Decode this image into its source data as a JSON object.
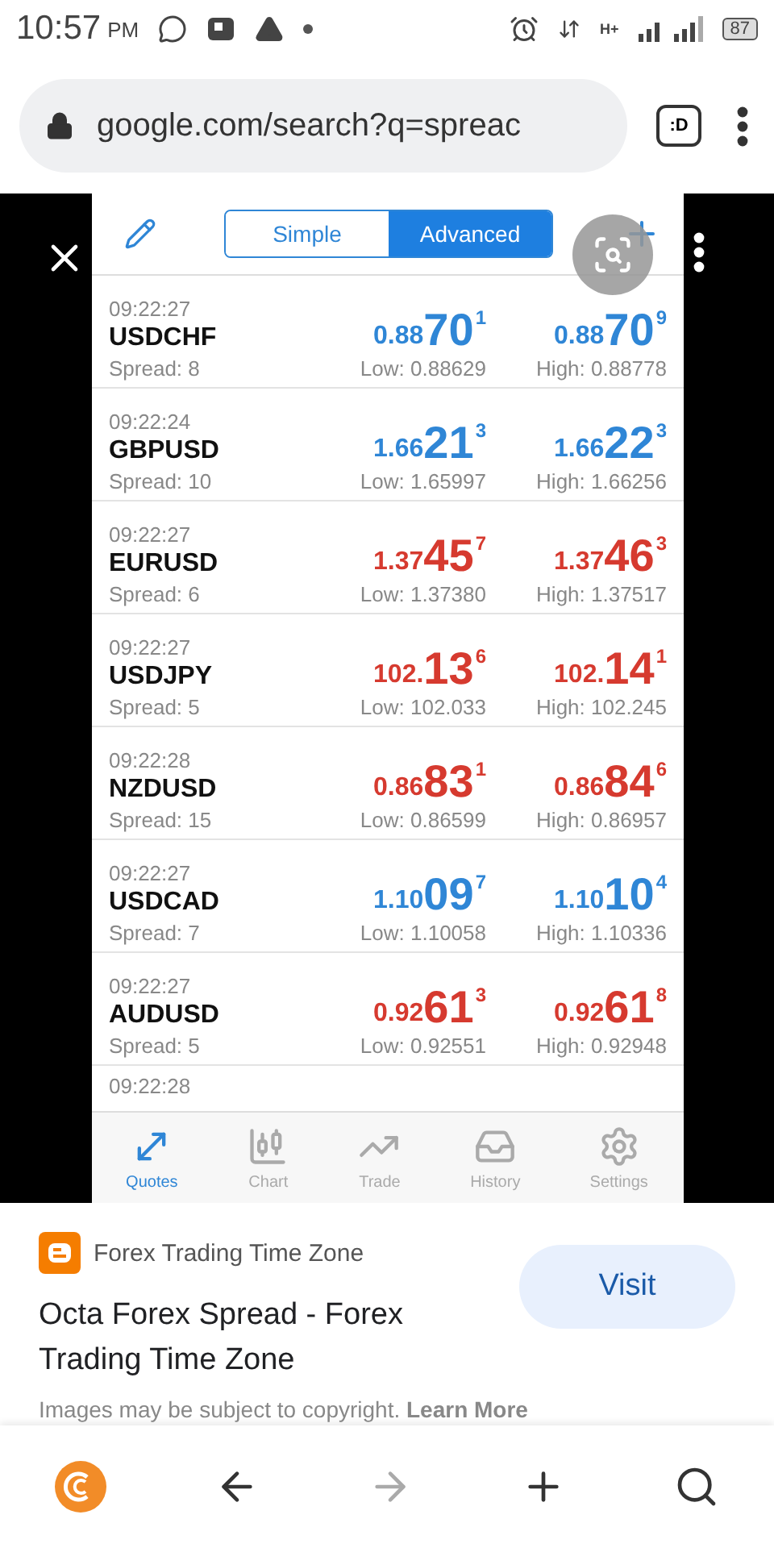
{
  "status_bar": {
    "time": "10:57",
    "ampm": "PM",
    "network": "H+",
    "battery": "87"
  },
  "address_bar": {
    "url": "google.com/search?q=spreac",
    "tab_switcher": ":D"
  },
  "viewer": {
    "segments": [
      {
        "label": "Simple",
        "selected": false
      },
      {
        "label": "Advanced",
        "selected": true
      }
    ],
    "quotes": [
      {
        "time": "09:22:27",
        "symbol": "USDCHF",
        "spread": "Spread: 8",
        "color": "#2f86d6",
        "bid": {
          "head": "0.88",
          "big": "70",
          "tail": "1"
        },
        "ask": {
          "head": "0.88",
          "big": "70",
          "tail": "9"
        },
        "low": "Low: 0.88629",
        "high": "High: 0.88778"
      },
      {
        "time": "09:22:24",
        "symbol": "GBPUSD",
        "spread": "Spread: 10",
        "color": "#2f86d6",
        "bid": {
          "head": "1.66",
          "big": "21",
          "tail": "3"
        },
        "ask": {
          "head": "1.66",
          "big": "22",
          "tail": "3"
        },
        "low": "Low: 1.65997",
        "high": "High: 1.66256"
      },
      {
        "time": "09:22:27",
        "symbol": "EURUSD",
        "spread": "Spread: 6",
        "color": "#d63a2f",
        "bid": {
          "head": "1.37",
          "big": "45",
          "tail": "7"
        },
        "ask": {
          "head": "1.37",
          "big": "46",
          "tail": "3"
        },
        "low": "Low: 1.37380",
        "high": "High: 1.37517"
      },
      {
        "time": "09:22:27",
        "symbol": "USDJPY",
        "spread": "Spread: 5",
        "color": "#d63a2f",
        "bid": {
          "head": "102.",
          "big": "13",
          "tail": "6"
        },
        "ask": {
          "head": "102.",
          "big": "14",
          "tail": "1"
        },
        "low": "Low: 102.033",
        "high": "High: 102.245"
      },
      {
        "time": "09:22:28",
        "symbol": "NZDUSD",
        "spread": "Spread: 15",
        "color": "#d63a2f",
        "bid": {
          "head": "0.86",
          "big": "83",
          "tail": "1"
        },
        "ask": {
          "head": "0.86",
          "big": "84",
          "tail": "6"
        },
        "low": "Low: 0.86599",
        "high": "High: 0.86957"
      },
      {
        "time": "09:22:27",
        "symbol": "USDCAD",
        "spread": "Spread: 7",
        "color": "#2f86d6",
        "bid": {
          "head": "1.10",
          "big": "09",
          "tail": "7"
        },
        "ask": {
          "head": "1.10",
          "big": "10",
          "tail": "4"
        },
        "low": "Low: 1.10058",
        "high": "High: 1.10336"
      },
      {
        "time": "09:22:27",
        "symbol": "AUDUSD",
        "spread": "Spread: 5",
        "color": "#d63a2f",
        "bid": {
          "head": "0.92",
          "big": "61",
          "tail": "3"
        },
        "ask": {
          "head": "0.92",
          "big": "61",
          "tail": "8"
        },
        "low": "Low: 0.92551",
        "high": "High: 0.92948"
      }
    ],
    "partial_quote": {
      "time": "09:22:28"
    },
    "tabs": [
      {
        "kind": "quotes",
        "label": "Quotes",
        "selected": true
      },
      {
        "kind": "chart",
        "label": "Chart",
        "selected": false
      },
      {
        "kind": "trade",
        "label": "Trade",
        "selected": false
      },
      {
        "kind": "history",
        "label": "History",
        "selected": false
      },
      {
        "kind": "settings",
        "label": "Settings",
        "selected": false
      }
    ]
  },
  "result": {
    "source": "Forex Trading Time Zone",
    "title": "Octa Forex Spread - Forex Trading Time Zone",
    "action": "Visit",
    "notice": "Images may be subject to copyright. **Learn More**"
  },
  "bottom_nav": [
    {
      "kind": "home",
      "disabled": false
    },
    {
      "kind": "back",
      "disabled": false
    },
    {
      "kind": "forward",
      "disabled": true
    },
    {
      "kind": "new-tab",
      "disabled": false
    },
    {
      "kind": "search",
      "disabled": false
    }
  ]
}
